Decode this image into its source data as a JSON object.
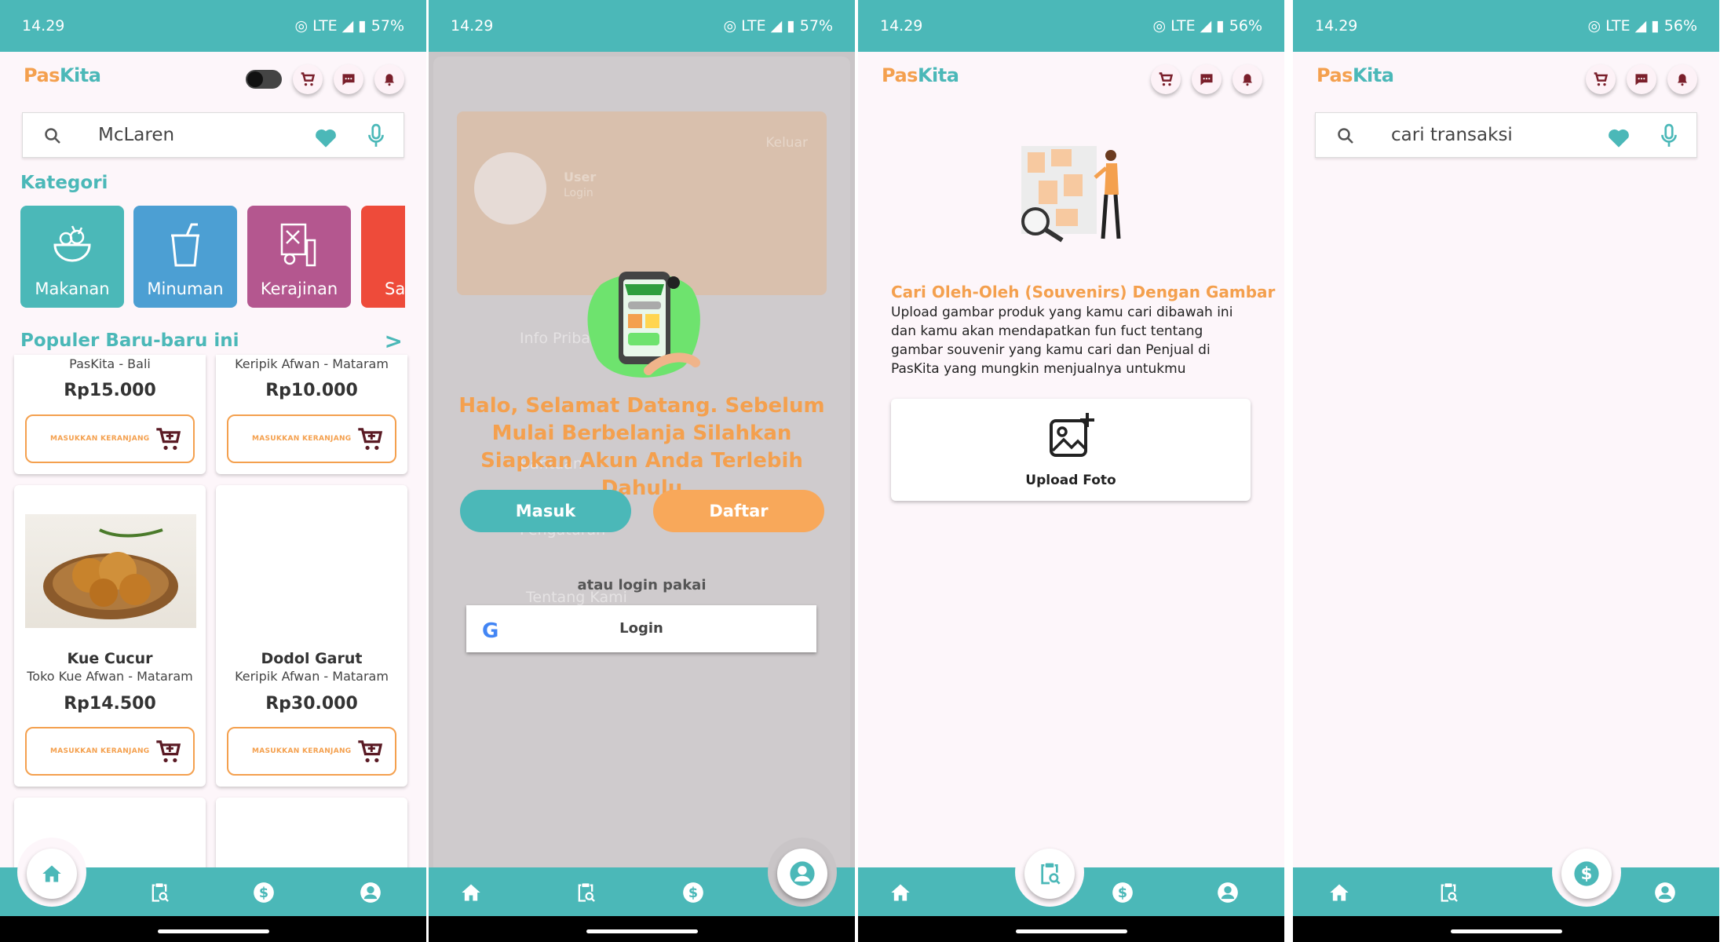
{
  "status": [
    {
      "time": "14.29",
      "network": "LTE",
      "battery": "57%"
    },
    {
      "time": "14.29",
      "network": "LTE",
      "battery": "57%"
    },
    {
      "time": "14.29",
      "network": "LTE",
      "battery": "56%"
    },
    {
      "time": "14.29",
      "network": "LTE",
      "battery": "56%"
    }
  ],
  "brand": {
    "part1": "Pas",
    "part2": "Kita"
  },
  "colors": {
    "teal": "#4bb8b8",
    "orange": "#f4a04e",
    "maroon": "#7a1f2b"
  },
  "home": {
    "search_value": "McLaren",
    "categories_title": "Kategori",
    "categories": [
      {
        "label": "Makanan",
        "color": "#4bb8b8"
      },
      {
        "label": "Minuman",
        "color": "#4c9fd3"
      },
      {
        "label": "Kerajinan",
        "color": "#b4578f"
      },
      {
        "label": "Sa",
        "color": "#ee4b3a"
      }
    ],
    "popular_title": "Populer Baru-baru ini",
    "see_more": ">",
    "cart_button_label": "MASUKKAN KERANJANG",
    "products_partial": [
      {
        "store": "PasKita - Bali",
        "price": "Rp15.000"
      },
      {
        "store": "Keripik Afwan - Mataram",
        "price": "Rp10.000"
      }
    ],
    "products": [
      {
        "name": "Kue Cucur",
        "store": "Toko Kue Afwan - Mataram",
        "price": "Rp14.500"
      },
      {
        "name": "Dodol Garut",
        "store": "Keripik Afwan - Mataram",
        "price": "Rp30.000"
      }
    ]
  },
  "login": {
    "bg_user_label": "User",
    "bg_user_sub": "Login",
    "bg_logout": "Keluar",
    "bg_menu": [
      "Info Pribadi",
      "Bantuan",
      "Pengaturan",
      "Tentang Kami"
    ],
    "welcome": "Halo, Selamat Datang. Sebelum Mulai Berbelanja Silahkan Siapkan Akun Anda Terlebih Dahulu",
    "masuk": "Masuk",
    "daftar": "Daftar",
    "or_text": "atau login pakai",
    "google_login": "Login"
  },
  "image_search": {
    "title": "Cari Oleh-Oleh (Souvenirs) Dengan Gambar",
    "description": "Upload gambar produk yang kamu cari dibawah ini dan kamu akan mendapatkan fun fuct tentang gambar souvenir yang kamu cari dan Penjual di PasKita yang mungkin menjualnya untukmu",
    "upload_label": "Upload Foto"
  },
  "transactions": {
    "search_placeholder": "cari transaksi"
  }
}
